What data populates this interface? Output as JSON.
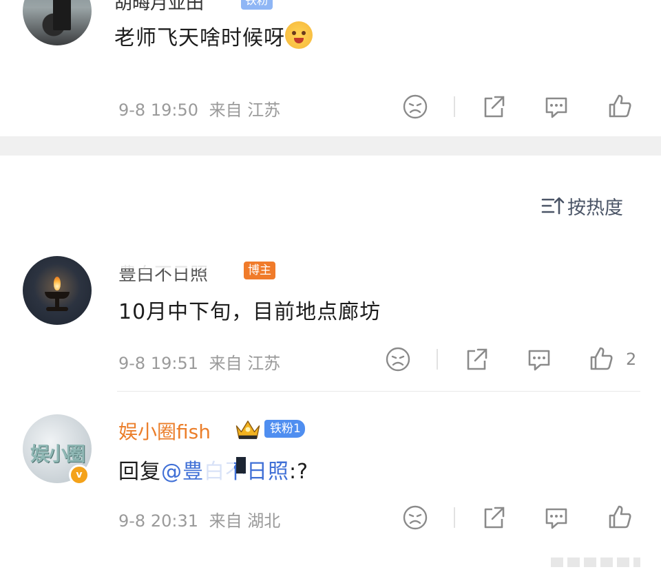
{
  "comments": [
    {
      "username": "胡晦月亚田",
      "badge": "铁粉",
      "content": "老师飞天啥时候呀",
      "time": "9-8 19:50",
      "location": "来自 江苏",
      "likes": ""
    },
    {
      "username": "豊白不日照",
      "badge": "博主",
      "content": "10月中下旬，目前地点廊坊",
      "time": "9-8 19:51",
      "location": "来自 江苏",
      "likes": "2"
    },
    {
      "username": "娱小圈fish",
      "badge": "铁粉1",
      "avatar_text": "娱小圈",
      "verified_mark": "v",
      "reply_prefix": "回复",
      "mention": "@豊白不日照",
      "content_suffix": ":?",
      "time": "9-8 20:31",
      "location": "来自 湖北",
      "likes": ""
    }
  ],
  "sort": {
    "label": "按热度"
  },
  "colors": {
    "username_accent": "#eb7e2a",
    "mention": "#3f6fd6",
    "bozhu_badge": "#f07b2a",
    "fan_badge": "#4f8ef0",
    "meta_text": "#9a9a9a",
    "separator": "#f0f0f0"
  },
  "icons": [
    "dislike-icon",
    "share-icon",
    "comment-icon",
    "like-icon",
    "sort-icon",
    "crown-icon"
  ]
}
